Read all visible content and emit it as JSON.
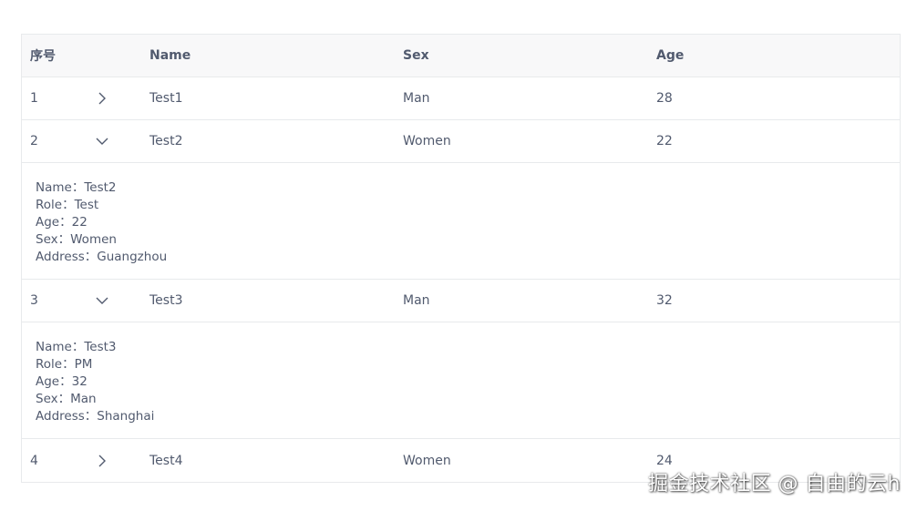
{
  "table": {
    "headers": {
      "index": "序号",
      "name": "Name",
      "sex": "Sex",
      "age": "Age"
    },
    "rows": [
      {
        "index": "1",
        "name": "Test1",
        "sex": "Man",
        "age": "28",
        "expanded": false
      },
      {
        "index": "2",
        "name": "Test2",
        "sex": "Women",
        "age": "22",
        "expanded": true,
        "detail": {
          "name": "Name：Test2",
          "role": "Role：Test",
          "age": "Age：22",
          "sex": "Sex：Women",
          "address": "Address：Guangzhou"
        }
      },
      {
        "index": "3",
        "name": "Test3",
        "sex": "Man",
        "age": "32",
        "expanded": true,
        "detail": {
          "name": "Name：Test3",
          "role": "Role：PM",
          "age": "Age：32",
          "sex": "Sex：Man",
          "address": "Address：Shanghai"
        }
      },
      {
        "index": "4",
        "name": "Test4",
        "sex": "Women",
        "age": "24",
        "expanded": false
      }
    ]
  },
  "watermark": "掘金技术社区 @ 自由的云h",
  "icons": {
    "collapsed": "chevron-right-icon",
    "expanded": "chevron-down-icon"
  },
  "colors": {
    "text": "#515a6e",
    "border": "#e8eaec",
    "header_bg": "#f8f8f9"
  }
}
